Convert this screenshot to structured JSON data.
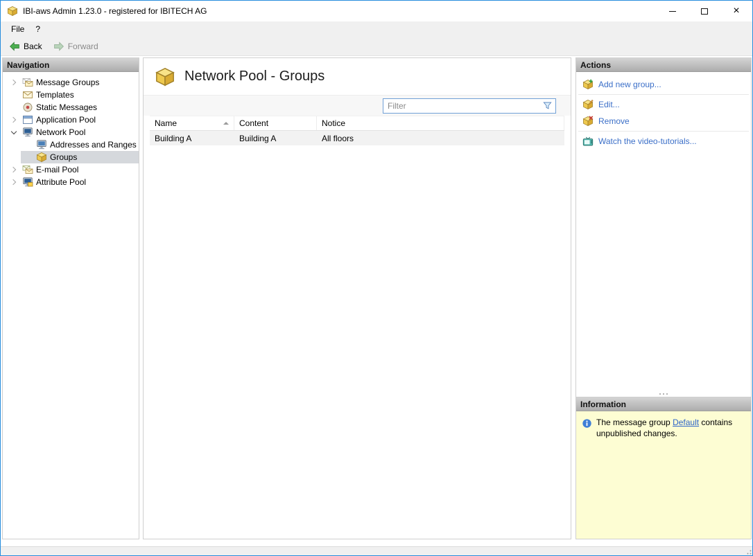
{
  "colors": {
    "window_border": "#268ddd",
    "link_blue": "#3b6fc8",
    "selection_gray": "#d5d8dc",
    "info_background": "#fdfdd3",
    "panel_header_top": "#d4d4d4",
    "panel_header_bottom": "#acacac",
    "row_background": "#f2f2f2"
  },
  "window": {
    "title": "IBI-aws Admin 1.23.0 - registered for IBITECH AG"
  },
  "menu": {
    "items": [
      {
        "label": "File"
      },
      {
        "label": "?"
      }
    ]
  },
  "toolbar": {
    "back_label": "Back",
    "forward_label": "Forward",
    "forward_enabled": false
  },
  "icons": {
    "app": "app-cube-icon",
    "back": "back-arrow-icon",
    "forward": "forward-arrow-icon",
    "page_title": "network-groups-icon",
    "filter": "filter-funnel-icon",
    "information": "info-icon",
    "sort": "sort-ascending-icon",
    "grip": "resize-grip-icon"
  },
  "navigation": {
    "header": "Navigation",
    "items": [
      {
        "label": "Message Groups",
        "icon": "message-groups-icon",
        "level": 0,
        "expandable": true,
        "expanded": false,
        "selected": false
      },
      {
        "label": "Templates",
        "icon": "templates-icon",
        "level": 0,
        "expandable": false,
        "expanded": false,
        "selected": false
      },
      {
        "label": "Static Messages",
        "icon": "static-messages-icon",
        "level": 0,
        "expandable": false,
        "expanded": false,
        "selected": false
      },
      {
        "label": "Application Pool",
        "icon": "application-pool-icon",
        "level": 0,
        "expandable": true,
        "expanded": false,
        "selected": false
      },
      {
        "label": "Network Pool",
        "icon": "network-pool-icon",
        "level": 0,
        "expandable": true,
        "expanded": true,
        "selected": false
      },
      {
        "label": "Addresses and Ranges",
        "icon": "addresses-and-ranges-icon",
        "level": 1,
        "expandable": false,
        "expanded": false,
        "selected": false
      },
      {
        "label": "Groups",
        "icon": "groups-icon",
        "level": 1,
        "expandable": false,
        "expanded": false,
        "selected": true
      },
      {
        "label": "E-mail Pool",
        "icon": "email-pool-icon",
        "level": 0,
        "expandable": true,
        "expanded": false,
        "selected": false
      },
      {
        "label": "Attribute Pool",
        "icon": "attribute-pool-icon",
        "level": 0,
        "expandable": true,
        "expanded": false,
        "selected": false
      }
    ]
  },
  "main": {
    "title": "Network Pool - Groups",
    "filter": {
      "placeholder": "Filter"
    },
    "table": {
      "columns": [
        {
          "label": "Name",
          "sorted": "asc"
        },
        {
          "label": "Content"
        },
        {
          "label": "Notice"
        }
      ],
      "rows": [
        {
          "name": "Building A",
          "content": "Building A",
          "notice": "All floors"
        }
      ]
    }
  },
  "actions": {
    "header": "Actions",
    "items": [
      {
        "label": "Add new group...",
        "icon": "add-group-icon",
        "divider_after": true
      },
      {
        "label": "Edit...",
        "icon": "edit-group-icon",
        "divider_after": false
      },
      {
        "label": "Remove",
        "icon": "remove-group-icon",
        "divider_after": true
      },
      {
        "label": "Watch the video-tutorials...",
        "icon": "video-tutorials-icon",
        "divider_after": false
      }
    ]
  },
  "information": {
    "header": "Information",
    "message": {
      "text_before": "The message group ",
      "link_text": "Default",
      "text_after": " contains unpublished changes."
    }
  }
}
